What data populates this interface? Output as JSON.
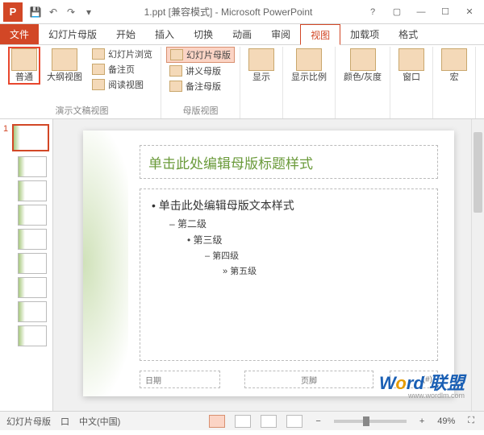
{
  "titlebar": {
    "title": "1.ppt [兼容模式] - Microsoft PowerPoint"
  },
  "tabs": {
    "file": "文件",
    "slideMaster": "幻灯片母版",
    "home": "开始",
    "insert": "插入",
    "transitions": "切换",
    "animations": "动画",
    "review": "审阅",
    "view": "视图",
    "addins": "加载项",
    "format": "格式"
  },
  "ribbon": {
    "presentationViews": {
      "normal": "普通",
      "outline": "大纲视图",
      "slideSorter": "幻灯片浏览",
      "notesPage": "备注页",
      "readingView": "阅读视图",
      "groupLabel": "演示文稿视图"
    },
    "masterViews": {
      "slideMaster": "幻灯片母版",
      "handoutMaster": "讲义母版",
      "notesMaster": "备注母版",
      "groupLabel": "母版视图"
    },
    "show": {
      "label": "显示"
    },
    "zoom": {
      "label": "显示比例"
    },
    "colorGray": {
      "label": "颜色/灰度"
    },
    "window": {
      "label": "窗口"
    },
    "macros": {
      "label": "宏"
    }
  },
  "slide": {
    "titlePlaceholder": "单击此处编辑母版标题样式",
    "bodyL1": "单击此处编辑母版文本样式",
    "bodyL2": "第二级",
    "bodyL3": "第三级",
    "bodyL4": "第四级",
    "bodyL5": "第五级",
    "date": "日期",
    "footer": "页脚",
    "slideNum": "(#)"
  },
  "watermark": {
    "text1": "W",
    "text2": "o",
    "text3": "rd 联盟",
    "sub": "www.wordlm.com"
  },
  "statusbar": {
    "mode": "幻灯片母版",
    "lang": "中文(中国)",
    "langIcon": "口",
    "zoom": "49%"
  },
  "thumbs": {
    "masterIndex": "1"
  }
}
